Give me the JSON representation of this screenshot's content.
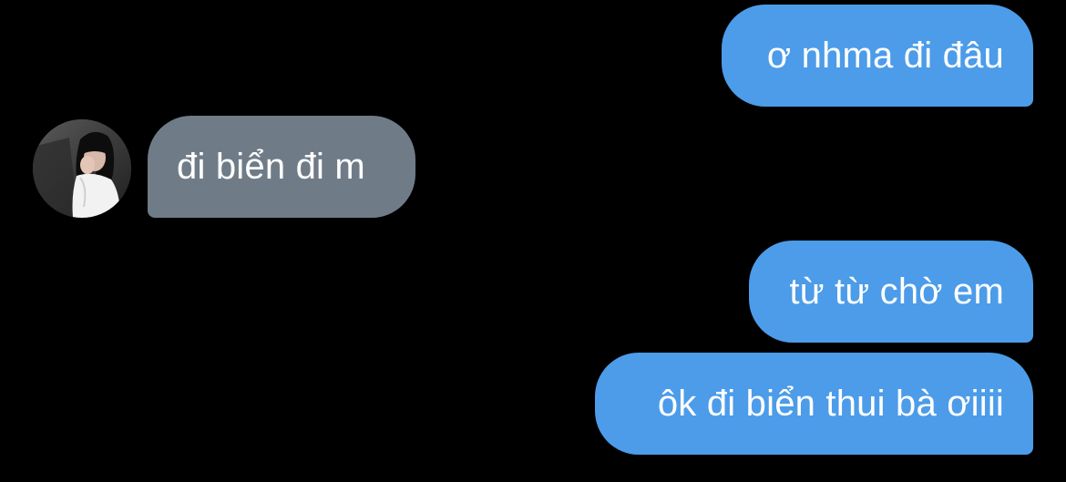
{
  "conversation": {
    "messages": [
      {
        "sender": "me",
        "text": "ơ nhma đi đâu"
      },
      {
        "sender": "other",
        "text": "đi biển đi m"
      },
      {
        "sender": "me",
        "text": "từ từ chờ em"
      },
      {
        "sender": "me",
        "text": "ôk đi biển thui bà ơiiii"
      }
    ],
    "contact_avatar": "avatar-photo"
  },
  "colors": {
    "background": "#000000",
    "outgoing_bubble": "#4c9ce9",
    "incoming_bubble": "#6f7c88",
    "text": "#ffffff"
  }
}
